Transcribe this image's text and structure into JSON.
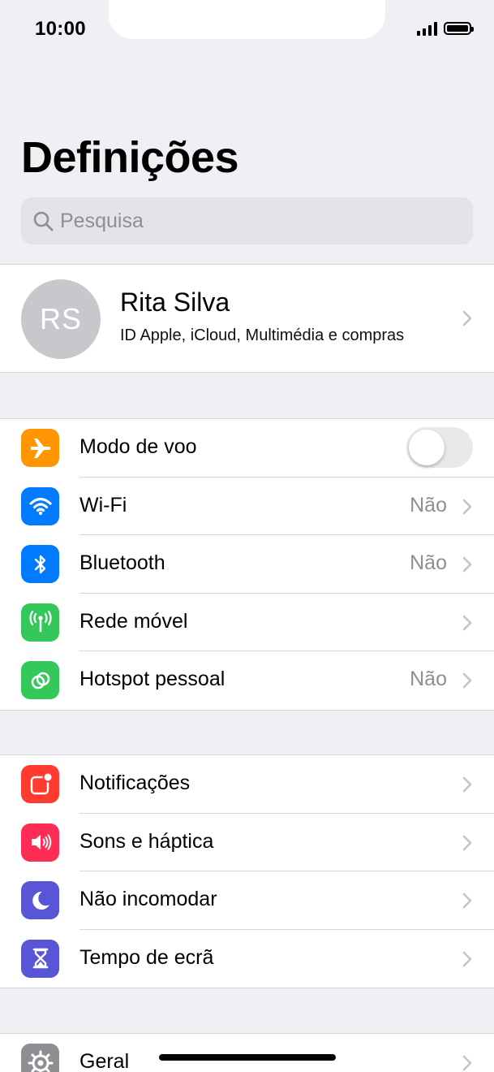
{
  "status_bar": {
    "time": "10:00"
  },
  "page": {
    "title": "Definições"
  },
  "search": {
    "placeholder": "Pesquisa"
  },
  "profile": {
    "initials": "RS",
    "name": "Rita Silva",
    "subtitle": "ID Apple, iCloud, Multimédia e compras"
  },
  "groups": {
    "connectivity": [
      {
        "label": "Modo de voo",
        "icon": "airplane-icon",
        "color": "#ff9500",
        "toggle": false
      },
      {
        "label": "Wi-Fi",
        "value": "Não",
        "icon": "wifi-icon",
        "color": "#007aff"
      },
      {
        "label": "Bluetooth",
        "value": "Não",
        "icon": "bluetooth-icon",
        "color": "#007aff"
      },
      {
        "label": "Rede móvel",
        "icon": "antenna-icon",
        "color": "#34c759"
      },
      {
        "label": "Hotspot pessoal",
        "value": "Não",
        "icon": "hotspot-icon",
        "color": "#34c759"
      }
    ],
    "notifications": [
      {
        "label": "Notificações",
        "icon": "notifications-icon",
        "color": "#ff3b30"
      },
      {
        "label": "Sons e háptica",
        "icon": "speaker-icon",
        "color": "#ff2d55"
      },
      {
        "label": "Não incomodar",
        "icon": "moon-icon",
        "color": "#5856d6"
      },
      {
        "label": "Tempo de ecrã",
        "icon": "hourglass-icon",
        "color": "#5856d6"
      }
    ],
    "general": [
      {
        "label": "Geral",
        "icon": "gear-icon",
        "color": "#8e8e93"
      }
    ]
  }
}
